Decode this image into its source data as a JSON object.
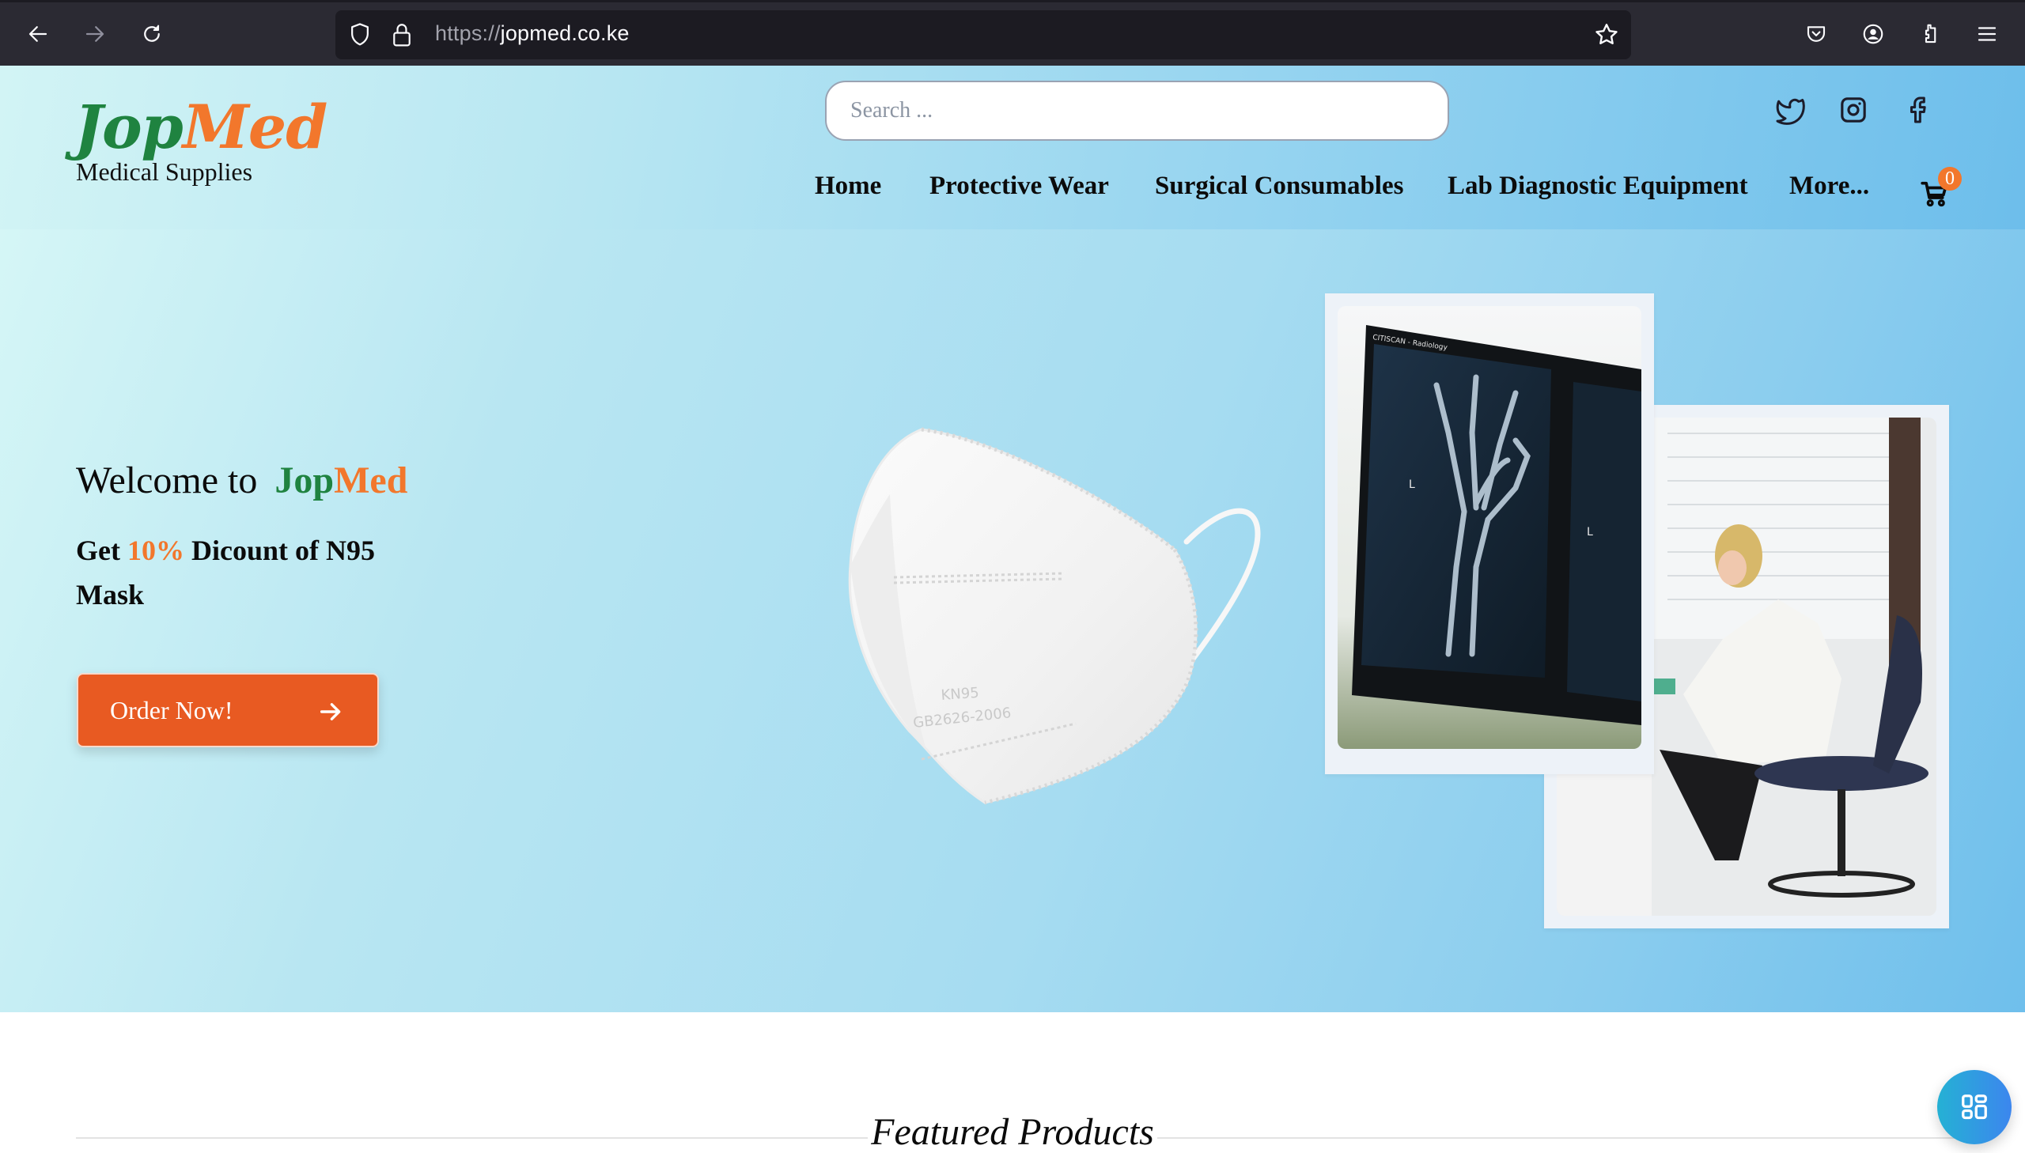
{
  "browser": {
    "url_scheme": "https://",
    "url_host": "jopmed.co.ke",
    "icons": [
      "back-icon",
      "forward-icon",
      "reload-icon",
      "shield-icon",
      "lock-icon",
      "bookmark-star-icon",
      "pocket-icon",
      "account-icon",
      "extensions-icon",
      "menu-icon"
    ]
  },
  "header": {
    "logo": {
      "part1": "Jop",
      "part2": "Med",
      "tagline": "Medical Supplies"
    },
    "search": {
      "placeholder": "Search ...",
      "value": ""
    },
    "social": [
      "twitter-icon",
      "instagram-icon",
      "facebook-icon"
    ],
    "nav": [
      {
        "label": "Home"
      },
      {
        "label": "Protective Wear"
      },
      {
        "label": "Surgical Consumables"
      },
      {
        "label": "Lab Diagnostic Equipment"
      },
      {
        "label": "More..."
      }
    ],
    "cart_count": "0"
  },
  "hero": {
    "welcome_prefix": "Welcome to",
    "brand_part1": "Jop",
    "brand_part2": "Med",
    "promo_get": "Get",
    "promo_percent": "10%",
    "promo_rest": "Dicount of N95 Mask",
    "cta_label": "Order Now!",
    "mask_text_1": "KN95",
    "mask_text_2": "GB2626-2006",
    "images": [
      {
        "name": "x-ray-image",
        "caption": "CITISCAN - Radiology"
      },
      {
        "name": "lab-scientist-image"
      }
    ]
  },
  "featured": {
    "title": "Featured Products"
  },
  "colors": {
    "brand_green": "#1f8340",
    "brand_orange": "#f2772c",
    "cta_orange": "#e85a22",
    "fab_start": "#25b1d4",
    "fab_end": "#3c86ee"
  }
}
